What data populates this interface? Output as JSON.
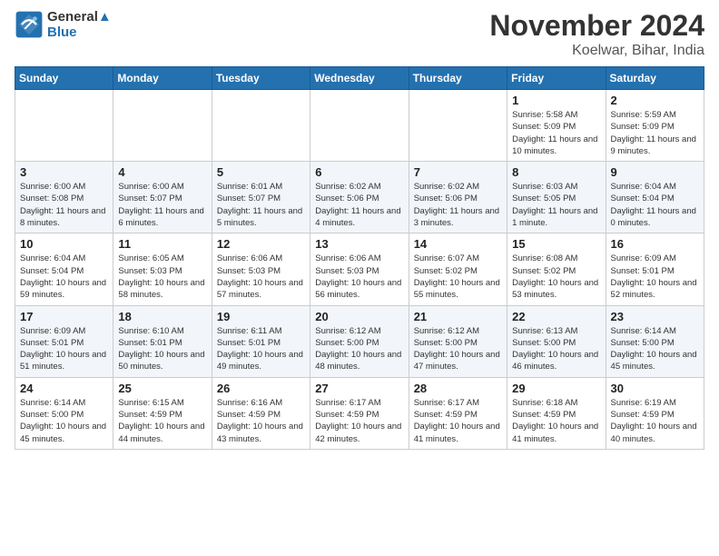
{
  "header": {
    "logo_line1": "General",
    "logo_line2": "Blue",
    "month_title": "November 2024",
    "location": "Koelwar, Bihar, India"
  },
  "days_of_week": [
    "Sunday",
    "Monday",
    "Tuesday",
    "Wednesday",
    "Thursday",
    "Friday",
    "Saturday"
  ],
  "weeks": [
    [
      {
        "day": "",
        "info": ""
      },
      {
        "day": "",
        "info": ""
      },
      {
        "day": "",
        "info": ""
      },
      {
        "day": "",
        "info": ""
      },
      {
        "day": "",
        "info": ""
      },
      {
        "day": "1",
        "info": "Sunrise: 5:58 AM\nSunset: 5:09 PM\nDaylight: 11 hours and 10 minutes."
      },
      {
        "day": "2",
        "info": "Sunrise: 5:59 AM\nSunset: 5:09 PM\nDaylight: 11 hours and 9 minutes."
      }
    ],
    [
      {
        "day": "3",
        "info": "Sunrise: 6:00 AM\nSunset: 5:08 PM\nDaylight: 11 hours and 8 minutes."
      },
      {
        "day": "4",
        "info": "Sunrise: 6:00 AM\nSunset: 5:07 PM\nDaylight: 11 hours and 6 minutes."
      },
      {
        "day": "5",
        "info": "Sunrise: 6:01 AM\nSunset: 5:07 PM\nDaylight: 11 hours and 5 minutes."
      },
      {
        "day": "6",
        "info": "Sunrise: 6:02 AM\nSunset: 5:06 PM\nDaylight: 11 hours and 4 minutes."
      },
      {
        "day": "7",
        "info": "Sunrise: 6:02 AM\nSunset: 5:06 PM\nDaylight: 11 hours and 3 minutes."
      },
      {
        "day": "8",
        "info": "Sunrise: 6:03 AM\nSunset: 5:05 PM\nDaylight: 11 hours and 1 minute."
      },
      {
        "day": "9",
        "info": "Sunrise: 6:04 AM\nSunset: 5:04 PM\nDaylight: 11 hours and 0 minutes."
      }
    ],
    [
      {
        "day": "10",
        "info": "Sunrise: 6:04 AM\nSunset: 5:04 PM\nDaylight: 10 hours and 59 minutes."
      },
      {
        "day": "11",
        "info": "Sunrise: 6:05 AM\nSunset: 5:03 PM\nDaylight: 10 hours and 58 minutes."
      },
      {
        "day": "12",
        "info": "Sunrise: 6:06 AM\nSunset: 5:03 PM\nDaylight: 10 hours and 57 minutes."
      },
      {
        "day": "13",
        "info": "Sunrise: 6:06 AM\nSunset: 5:03 PM\nDaylight: 10 hours and 56 minutes."
      },
      {
        "day": "14",
        "info": "Sunrise: 6:07 AM\nSunset: 5:02 PM\nDaylight: 10 hours and 55 minutes."
      },
      {
        "day": "15",
        "info": "Sunrise: 6:08 AM\nSunset: 5:02 PM\nDaylight: 10 hours and 53 minutes."
      },
      {
        "day": "16",
        "info": "Sunrise: 6:09 AM\nSunset: 5:01 PM\nDaylight: 10 hours and 52 minutes."
      }
    ],
    [
      {
        "day": "17",
        "info": "Sunrise: 6:09 AM\nSunset: 5:01 PM\nDaylight: 10 hours and 51 minutes."
      },
      {
        "day": "18",
        "info": "Sunrise: 6:10 AM\nSunset: 5:01 PM\nDaylight: 10 hours and 50 minutes."
      },
      {
        "day": "19",
        "info": "Sunrise: 6:11 AM\nSunset: 5:01 PM\nDaylight: 10 hours and 49 minutes."
      },
      {
        "day": "20",
        "info": "Sunrise: 6:12 AM\nSunset: 5:00 PM\nDaylight: 10 hours and 48 minutes."
      },
      {
        "day": "21",
        "info": "Sunrise: 6:12 AM\nSunset: 5:00 PM\nDaylight: 10 hours and 47 minutes."
      },
      {
        "day": "22",
        "info": "Sunrise: 6:13 AM\nSunset: 5:00 PM\nDaylight: 10 hours and 46 minutes."
      },
      {
        "day": "23",
        "info": "Sunrise: 6:14 AM\nSunset: 5:00 PM\nDaylight: 10 hours and 45 minutes."
      }
    ],
    [
      {
        "day": "24",
        "info": "Sunrise: 6:14 AM\nSunset: 5:00 PM\nDaylight: 10 hours and 45 minutes."
      },
      {
        "day": "25",
        "info": "Sunrise: 6:15 AM\nSunset: 4:59 PM\nDaylight: 10 hours and 44 minutes."
      },
      {
        "day": "26",
        "info": "Sunrise: 6:16 AM\nSunset: 4:59 PM\nDaylight: 10 hours and 43 minutes."
      },
      {
        "day": "27",
        "info": "Sunrise: 6:17 AM\nSunset: 4:59 PM\nDaylight: 10 hours and 42 minutes."
      },
      {
        "day": "28",
        "info": "Sunrise: 6:17 AM\nSunset: 4:59 PM\nDaylight: 10 hours and 41 minutes."
      },
      {
        "day": "29",
        "info": "Sunrise: 6:18 AM\nSunset: 4:59 PM\nDaylight: 10 hours and 41 minutes."
      },
      {
        "day": "30",
        "info": "Sunrise: 6:19 AM\nSunset: 4:59 PM\nDaylight: 10 hours and 40 minutes."
      }
    ]
  ]
}
